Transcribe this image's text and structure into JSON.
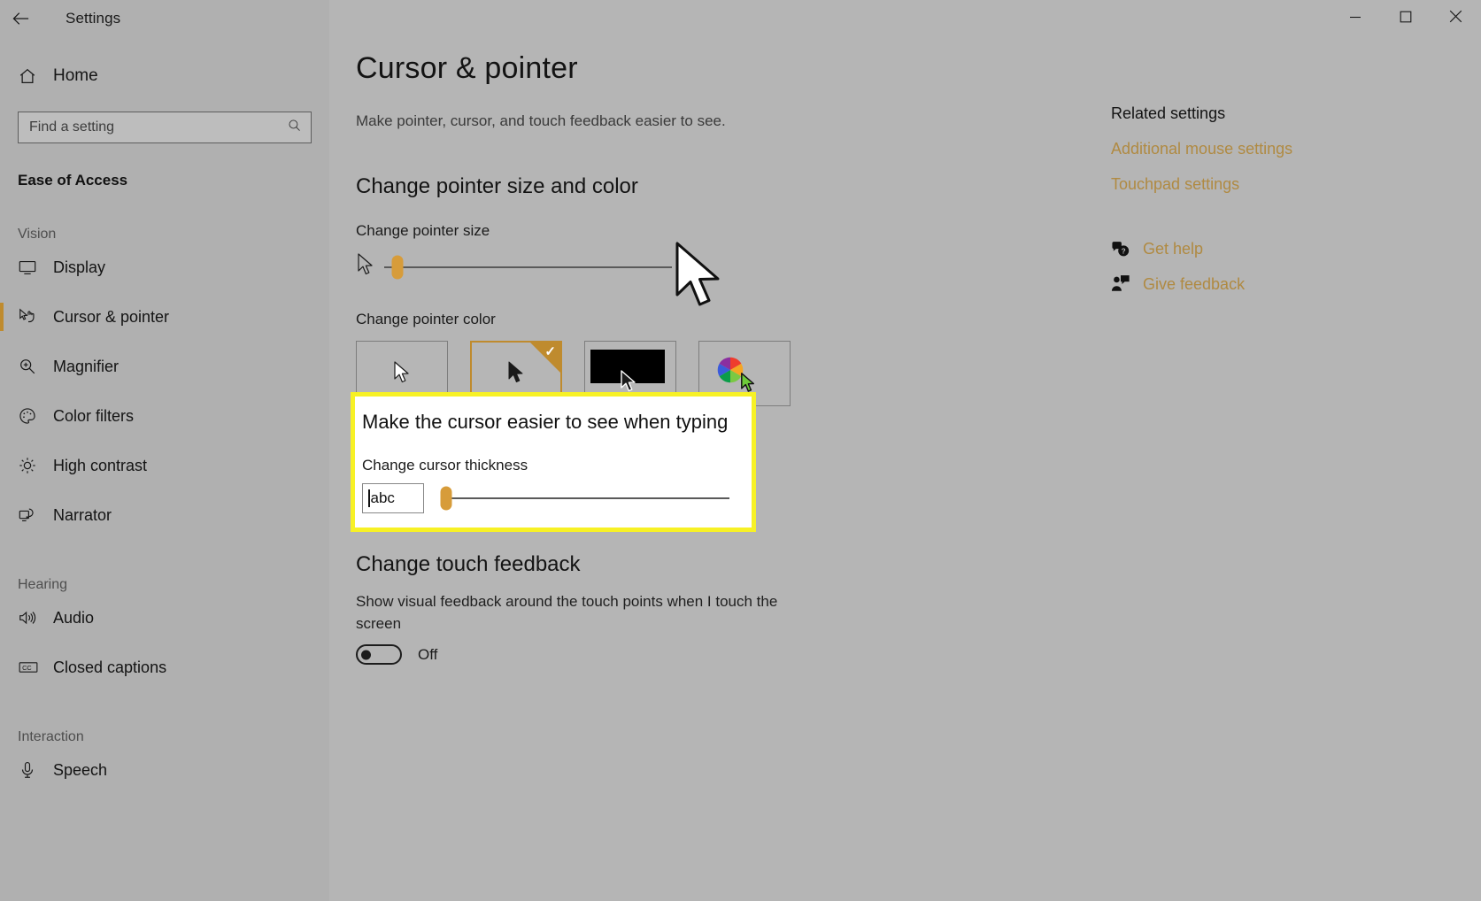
{
  "window": {
    "app_title": "Settings",
    "back_icon": "back-arrow-icon",
    "minimize_icon": "minimize-icon",
    "maximize_icon": "maximize-icon",
    "close_icon": "close-icon"
  },
  "sidebar": {
    "home_label": "Home",
    "home_icon": "home-icon",
    "search": {
      "placeholder": "Find a setting",
      "value": "",
      "icon": "search-icon"
    },
    "category": "Ease of Access",
    "groups": [
      {
        "label": "Vision",
        "items": [
          {
            "label": "Display",
            "icon": "monitor-icon",
            "active": false
          },
          {
            "label": "Cursor & pointer",
            "icon": "cursor-pointer-icon",
            "active": true
          },
          {
            "label": "Magnifier",
            "icon": "magnifier-icon",
            "active": false
          },
          {
            "label": "Color filters",
            "icon": "palette-icon",
            "active": false
          },
          {
            "label": "High contrast",
            "icon": "sun-icon",
            "active": false
          },
          {
            "label": "Narrator",
            "icon": "narrator-icon",
            "active": false
          }
        ]
      },
      {
        "label": "Hearing",
        "items": [
          {
            "label": "Audio",
            "icon": "speaker-icon",
            "active": false
          },
          {
            "label": "Closed captions",
            "icon": "cc-icon",
            "active": false
          }
        ]
      },
      {
        "label": "Interaction",
        "items": [
          {
            "label": "Speech",
            "icon": "microphone-icon",
            "active": false
          }
        ]
      }
    ]
  },
  "main": {
    "title": "Cursor & pointer",
    "subtitle": "Make pointer, cursor, and touch feedback easier to see.",
    "pointer_section": {
      "heading": "Change pointer size and color",
      "size_label": "Change pointer size",
      "size_value": 6,
      "size_min": 1,
      "size_max": 100,
      "color_label": "Change pointer color",
      "color_options": [
        {
          "name": "white-pointer",
          "selected": false
        },
        {
          "name": "black-pointer",
          "selected": true
        },
        {
          "name": "inverted-pointer",
          "selected": false
        },
        {
          "name": "custom-color-pointer",
          "selected": false
        }
      ]
    },
    "cursor_section": {
      "heading": "Make the cursor easier to see when typing",
      "thickness_label": "Change cursor thickness",
      "preview_text": "abc",
      "thickness_value": 2,
      "thickness_min": 1,
      "thickness_max": 20,
      "highlight_color": "#f7f125"
    },
    "touch_section": {
      "heading": "Change touch feedback",
      "description": "Show visual feedback around the touch points when I touch the screen",
      "toggle_state": "Off",
      "toggle_on": false
    }
  },
  "related": {
    "title": "Related settings",
    "links": [
      {
        "label": "Additional mouse settings"
      },
      {
        "label": "Touchpad settings"
      }
    ],
    "help": [
      {
        "label": "Get help",
        "icon": "help-bubble-icon"
      },
      {
        "label": "Give feedback",
        "icon": "feedback-icon"
      }
    ],
    "link_color": "#b08a42"
  }
}
